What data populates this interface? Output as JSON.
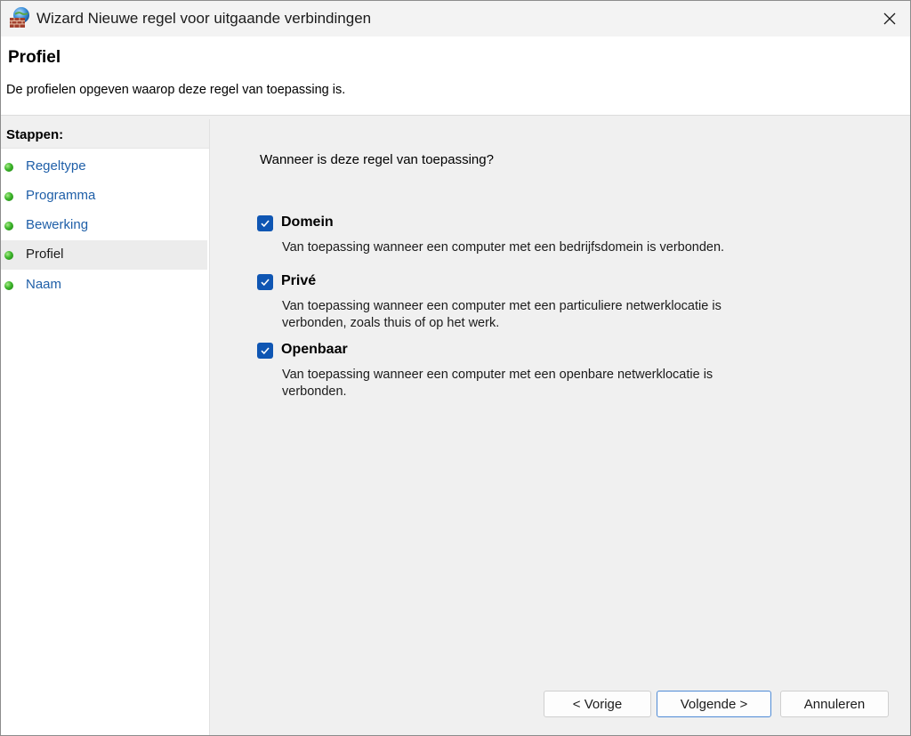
{
  "window": {
    "title": "Wizard Nieuwe regel voor uitgaande verbindingen"
  },
  "header": {
    "title": "Profiel",
    "subtitle": "De profielen opgeven waarop deze regel van toepassing is."
  },
  "sidebar": {
    "heading": "Stappen:",
    "steps": [
      {
        "label": "Regeltype"
      },
      {
        "label": "Programma"
      },
      {
        "label": "Bewerking"
      },
      {
        "label": "Profiel"
      },
      {
        "label": "Naam"
      }
    ],
    "active_step": "Profiel"
  },
  "main": {
    "question": "Wanneer is deze regel van toepassing?",
    "options": [
      {
        "title": "Domein",
        "checked": true,
        "description": "Van toepassing wanneer een computer met een bedrijfsdomein is verbonden."
      },
      {
        "title": "Privé",
        "checked": true,
        "description": "Van toepassing wanneer een computer met een particuliere netwerklocatie is verbonden, zoals thuis of op het werk."
      },
      {
        "title": "Openbaar",
        "checked": true,
        "description": "Van toepassing wanneer een computer met een openbare netwerklocatie is verbonden."
      }
    ]
  },
  "buttons": {
    "back": "< Vorige",
    "next": "Volgende >",
    "cancel": "Annuleren"
  },
  "colors": {
    "accent": "#0f56b3",
    "link": "#1f5fa8",
    "step_indicator": "#3cb52a"
  },
  "icons": {
    "app": "firewall-globe-icon",
    "close": "close-icon",
    "check": "checkmark-icon",
    "step": "green-dot-icon"
  }
}
